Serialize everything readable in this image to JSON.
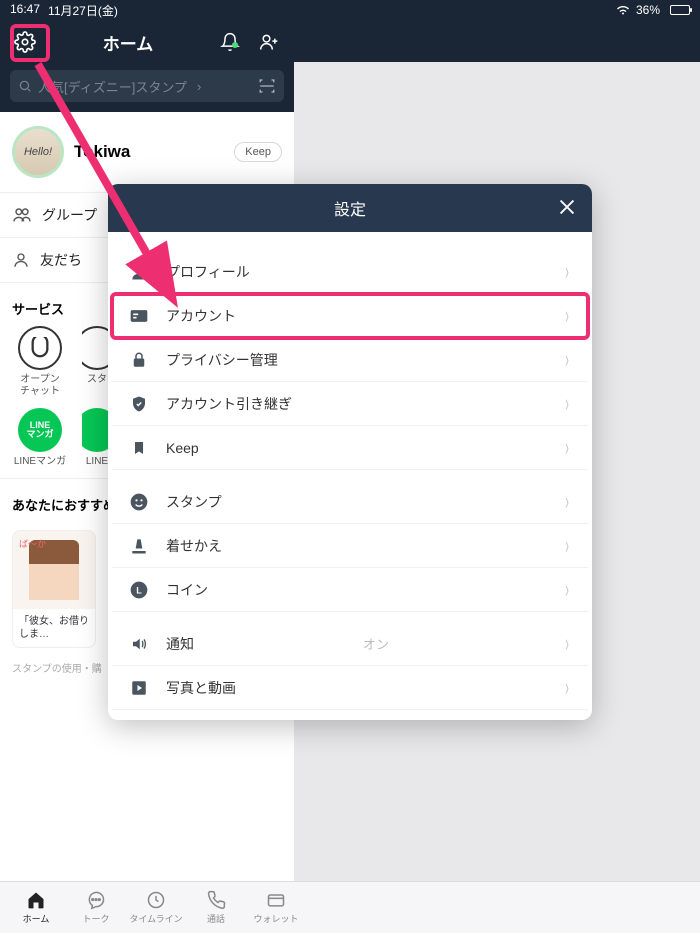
{
  "statusbar": {
    "time": "16:47",
    "date": "11月27日(金)",
    "battery_pct": "36%"
  },
  "home": {
    "title": "ホーム",
    "search_placeholder": "人気[ディズニー]スタンプ",
    "profile_name": "Tokiwa",
    "keep_label": "Keep",
    "groups_label": "グループ",
    "friends_label": "友だち",
    "services_title": "サービス",
    "services": [
      {
        "label": "オープン\nチャット"
      },
      {
        "label": "スタ"
      },
      {
        "label": "LINEマンガ",
        "badge": "LINE\nマンガ"
      },
      {
        "label": "LINE"
      }
    ],
    "recommend_title": "あなたにおすすめ",
    "recommend_card_caption": "「彼女、お借りしま…",
    "recommend_footnote": "スタンプの使用・購"
  },
  "tabbar": {
    "items": [
      {
        "label": "ホーム"
      },
      {
        "label": "トーク"
      },
      {
        "label": "タイムライン"
      },
      {
        "label": "通話"
      },
      {
        "label": "ウォレット"
      }
    ]
  },
  "settings_modal": {
    "title": "設定",
    "rows": [
      {
        "icon": "person",
        "label": "プロフィール"
      },
      {
        "icon": "card",
        "label": "アカウント",
        "highlighted": true
      },
      {
        "icon": "lock",
        "label": "プライバシー管理"
      },
      {
        "icon": "shield",
        "label": "アカウント引き継ぎ"
      },
      {
        "icon": "bookmark",
        "label": "Keep"
      }
    ],
    "rows2": [
      {
        "icon": "smile",
        "label": "スタンプ"
      },
      {
        "icon": "brush",
        "label": "着せかえ"
      },
      {
        "icon": "coin",
        "label": "コイン"
      }
    ],
    "rows3": [
      {
        "icon": "speaker",
        "label": "通知",
        "status": "オン"
      },
      {
        "icon": "play",
        "label": "写真と動画"
      }
    ]
  },
  "colors": {
    "accent": "#ed2f72",
    "header": "#1a2636"
  }
}
